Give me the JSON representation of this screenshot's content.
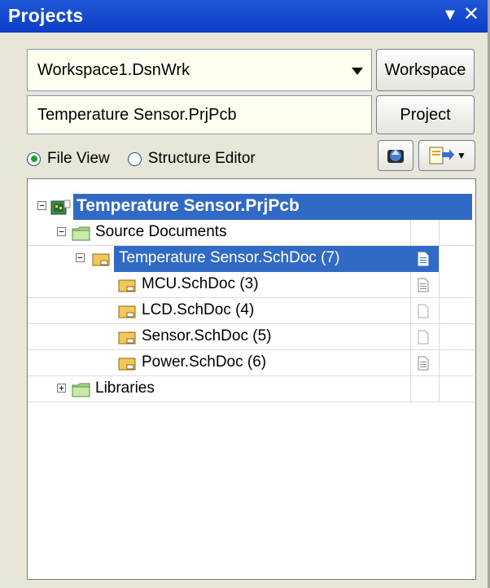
{
  "panel": {
    "title": "Projects",
    "pin_glyph": "▾",
    "close_glyph": "✕"
  },
  "workspace": {
    "value": "Workspace1.DsnWrk",
    "button_label": "Workspace"
  },
  "project": {
    "value": "Temperature Sensor.PrjPcb",
    "button_label": "Project"
  },
  "view_mode": {
    "options": [
      "File View",
      "Structure Editor"
    ],
    "selected": "File View"
  },
  "tree": {
    "root": {
      "label": "Temperature Sensor.PrjPcb",
      "expanded": true,
      "selected": true
    },
    "source_documents": {
      "label": "Source Documents",
      "expanded": true
    },
    "items": [
      {
        "label": "Temperature Sensor.SchDoc (7)",
        "indent": 1,
        "selected": true,
        "doc_icon": "lined-doc",
        "expander": "−"
      },
      {
        "label": "MCU.SchDoc (3)",
        "indent": 2,
        "selected": false,
        "doc_icon": "lined-doc"
      },
      {
        "label": "LCD.SchDoc (4)",
        "indent": 2,
        "selected": false,
        "doc_icon": "blank-doc"
      },
      {
        "label": "Sensor.SchDoc (5)",
        "indent": 2,
        "selected": false,
        "doc_icon": "blank-doc"
      },
      {
        "label": "Power.SchDoc (6)",
        "indent": 2,
        "selected": false,
        "doc_icon": "lined-doc"
      }
    ],
    "libraries": {
      "label": "Libraries",
      "expanded": false
    }
  },
  "colors": {
    "titlebar": "#0b3cc6",
    "selection": "#316ac5",
    "panel_bg": "#e8e6d9"
  }
}
